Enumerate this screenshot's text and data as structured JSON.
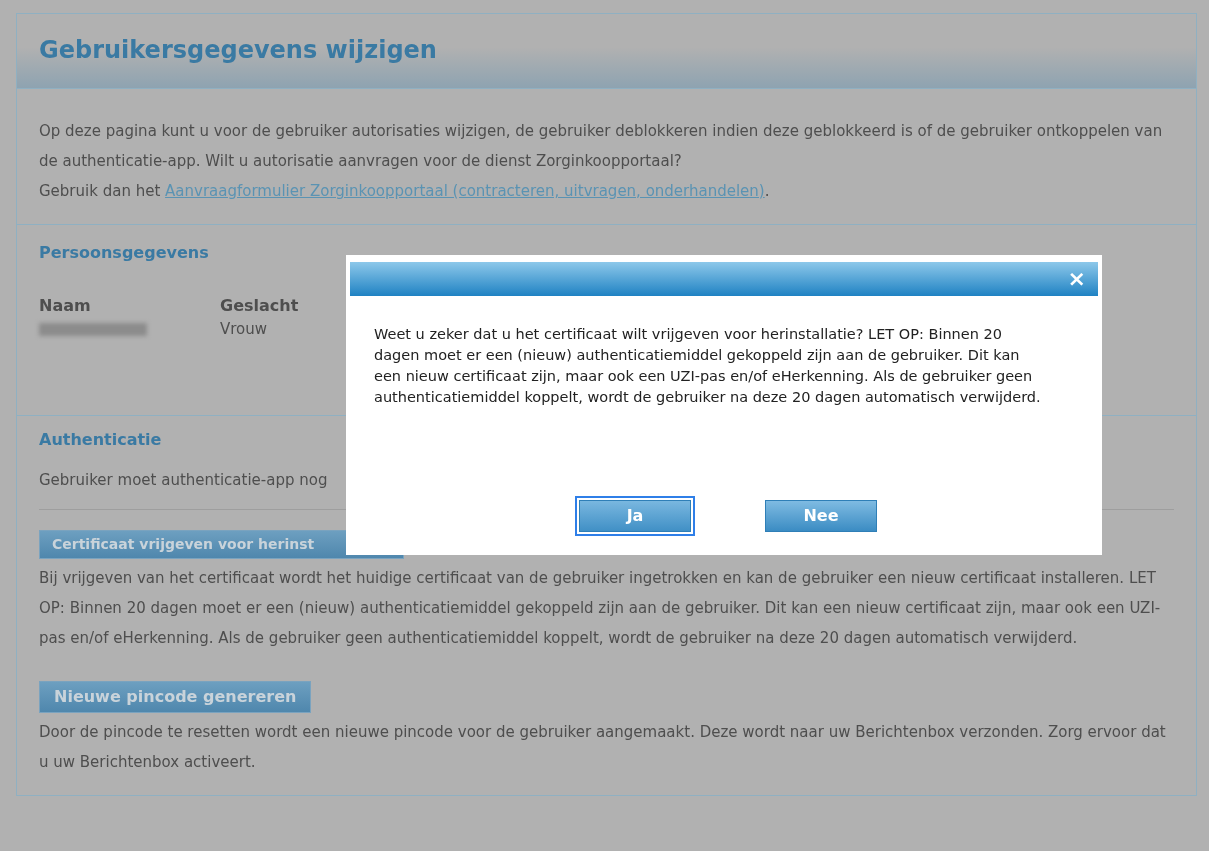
{
  "page": {
    "title": "Gebruikersgegevens wijzigen",
    "intro": {
      "text": "Op deze pagina kunt u voor de gebruiker autorisaties wijzigen, de gebruiker deblokkeren indien deze geblokkeerd is of de gebruiker ontkoppelen van de authenticatie-app. Wilt u autorisatie aanvragen voor de dienst Zorginkoopportaal?",
      "link_prefix": "Gebruik dan het ",
      "link": "Aanvraagformulier Zorginkoopportaal (contracteren, uitvragen, onderhandelen)",
      "suffix": "."
    }
  },
  "persoonsgegevens": {
    "heading": "Persoonsgegevens",
    "fields": [
      {
        "label": "Naam",
        "kind": "redacted"
      },
      {
        "label": "Geslacht",
        "kind": "text",
        "value": "Vrouw"
      }
    ]
  },
  "authenticatie": {
    "heading": "Authenticatie",
    "status": "Gebruiker moet authenticatie-app nog",
    "actions": [
      {
        "button": "Certificaat vrijgeven voor herinst",
        "description": "Bij vrijgeven van het certificaat wordt het huidige certificaat van de gebruiker ingetrokken en kan de gebruiker een nieuw certificaat installeren. LET OP: Binnen 20 dagen moet er een (nieuw) authenticatiemiddel gekoppeld zijn aan de gebruiker. Dit kan een nieuw certificaat zijn, maar ook een UZI-pas en/of eHerkenning. Als de gebruiker geen authenticatiemiddel koppelt, wordt de gebruiker na deze 20 dagen automatisch verwijderd."
      },
      {
        "button": "Nieuwe pincode genereren",
        "description": "Door de pincode te resetten wordt een nieuwe pincode voor de gebruiker aangemaakt. Deze wordt naar uw Berichtenbox verzonden. Zorg ervoor dat u uw Berichtenbox activeert."
      }
    ]
  },
  "dialog": {
    "close": "×",
    "message": "Weet u zeker dat u het certificaat wilt vrijgeven voor herinstallatie? LET OP: Binnen 20 dagen moet er een (nieuw) authenticatiemiddel gekoppeld zijn aan de gebruiker. Dit kan een nieuw certificaat zijn, maar ook een UZI-pas en/of eHerkenning. Als de gebruiker geen authenticatiemiddel koppelt, wordt de gebruiker na deze 20 dagen automatisch verwijderd.",
    "buttons": [
      {
        "label": "Ja",
        "focused": true
      },
      {
        "label": "Nee",
        "focused": false
      }
    ]
  }
}
